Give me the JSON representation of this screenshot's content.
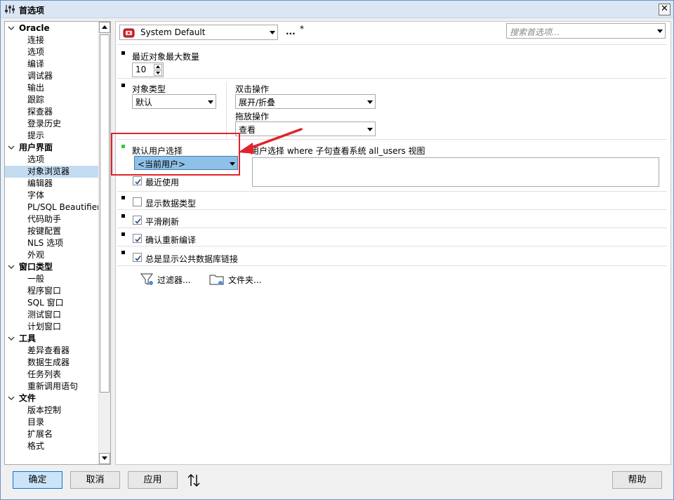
{
  "window": {
    "title": "首选项",
    "close": "✕"
  },
  "tree": {
    "groups": [
      {
        "label": "Oracle",
        "items": [
          "连接",
          "选项",
          "编译",
          "调试器",
          "输出",
          "跟踪",
          "探查器",
          "登录历史",
          "提示"
        ]
      },
      {
        "label": "用户界面",
        "items": [
          "选项",
          "对象浏览器",
          "编辑器",
          "字体",
          "PL/SQL Beautifier",
          "代码助手",
          "按键配置",
          "NLS 选项",
          "外观"
        ]
      },
      {
        "label": "窗口类型",
        "items": [
          "一般",
          "程序窗口",
          "SQL 窗口",
          "测试窗口",
          "计划窗口"
        ]
      },
      {
        "label": "工具",
        "items": [
          "差异查看器",
          "数据生成器",
          "任务列表",
          "重新调用语句"
        ]
      },
      {
        "label": "文件",
        "items": [
          "版本控制",
          "目录",
          "扩展名",
          "格式"
        ]
      }
    ],
    "selected": "对象浏览器"
  },
  "toolbar": {
    "profile": "System Default",
    "more": "...",
    "modified_marker": "*",
    "search_placeholder": "搜索首选项..."
  },
  "settings": {
    "max_objects_label": "最近对象最大数量",
    "max_objects_value": "10",
    "object_type_label": "对象类型",
    "object_type_value": "默认",
    "double_click_label": "双击操作",
    "double_click_value": "展开/折叠",
    "drag_drop_label": "拖放操作",
    "drag_drop_value": "查看",
    "default_user_label": "默认用户选择",
    "default_user_value": "<当前用户>",
    "where_clause_label": "用户选择 where 子句查看系统 all_users 视图",
    "recent_use_label": "最近使用",
    "show_data_types_label": "显示数据类型",
    "smooth_refresh_label": "平滑刷新",
    "confirm_recompile_label": "确认重新编译",
    "show_public_db_links_label": "总是显示公共数据库链接",
    "filter_label": "过滤器...",
    "folder_label": "文件夹..."
  },
  "checks": {
    "recent_use": true,
    "show_data_types": false,
    "smooth_refresh": true,
    "confirm_recompile": true,
    "show_public_db_links": true
  },
  "buttons": {
    "ok": "确定",
    "cancel": "取消",
    "apply": "应用",
    "help": "帮助"
  },
  "colors": {
    "highlight_box": "#e0242b",
    "arrow": "#e0242b",
    "selection": "#c3dcf2",
    "modified_bullet": "#2ecc40"
  }
}
